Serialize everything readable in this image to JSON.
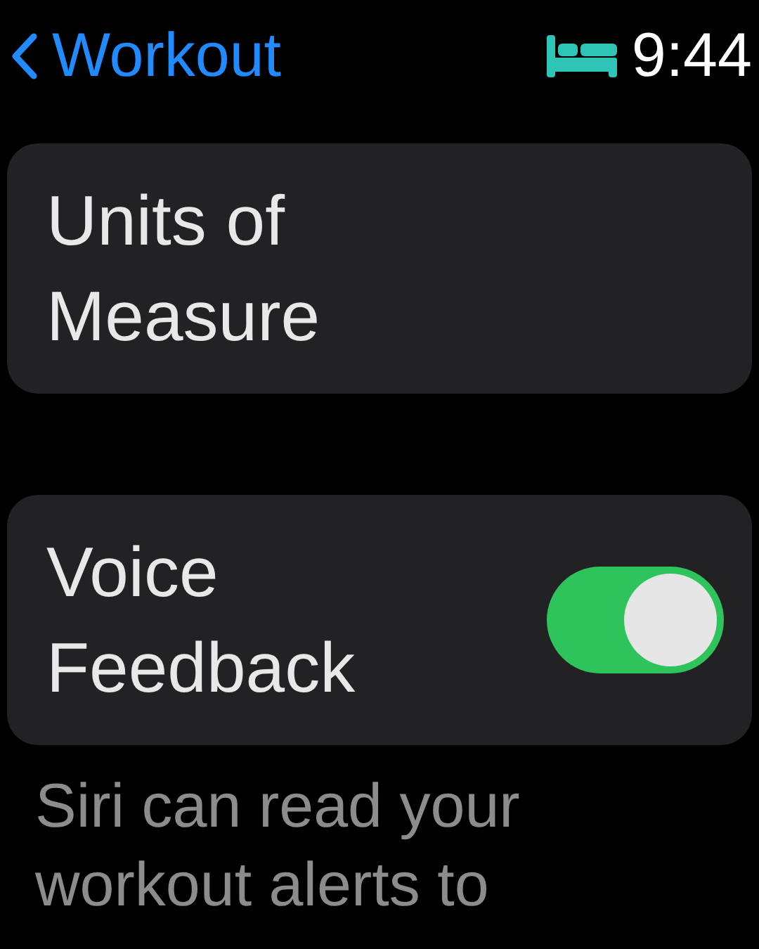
{
  "header": {
    "back_label": "Workout",
    "time": "9:44"
  },
  "rows": [
    {
      "kind": "link",
      "label": "Units of Measure"
    },
    {
      "kind": "toggle",
      "label": "Voice Feedback",
      "on": true
    }
  ],
  "footnote": "Siri can read your workout alerts to"
}
